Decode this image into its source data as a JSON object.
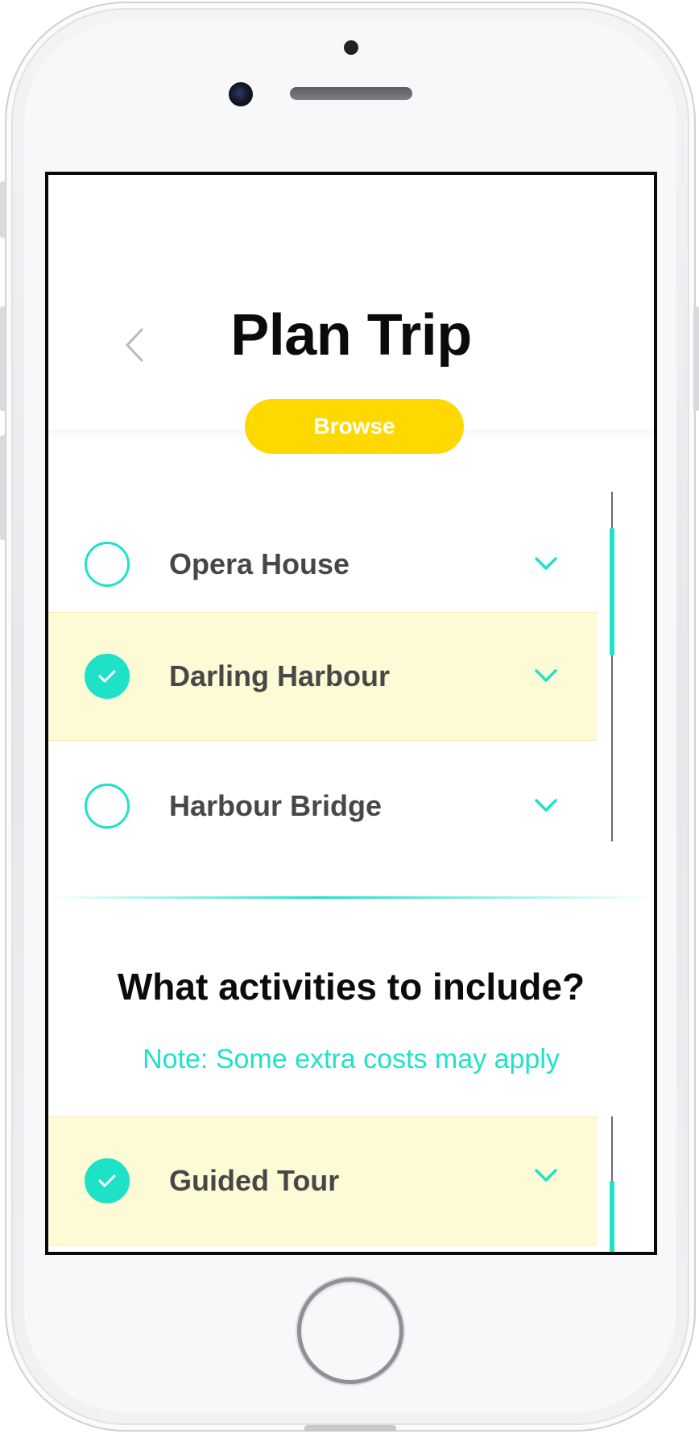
{
  "header": {
    "title": "Plan Trip",
    "back_icon": "chevron-left-icon",
    "browse_label": "Browse"
  },
  "locations": {
    "items": [
      {
        "label": "Opera House",
        "checked": false
      },
      {
        "label": "Darling Harbour",
        "checked": true
      },
      {
        "label": "Harbour Bridge",
        "checked": false
      }
    ]
  },
  "activities": {
    "title": "What activities to include?",
    "note": "Note: Some extra costs may apply",
    "items": [
      {
        "label": "Guided Tour",
        "checked": true
      }
    ]
  },
  "colors": {
    "accent": "#1ee2c8",
    "brand_yellow": "#ffd800",
    "selected_row": "#fdfad6",
    "label_text": "#474747",
    "title_text": "#0b0b0b"
  }
}
